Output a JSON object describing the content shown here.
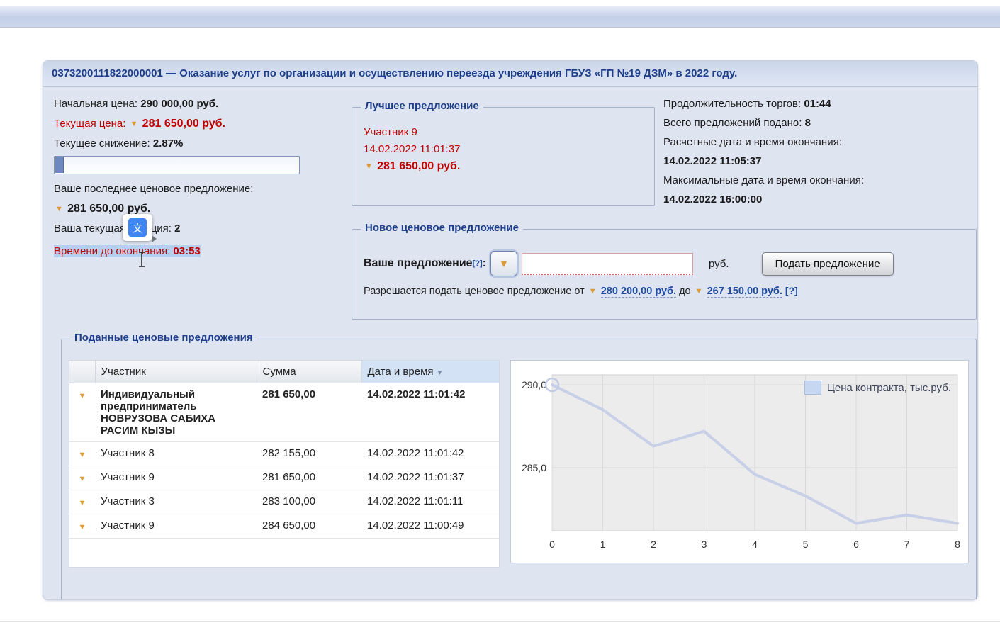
{
  "title": "0373200111822000001 — Оказание услуг по организации и осуществлению переезда учреждения ГБУЗ «ГП №19 ДЗМ» в 2022 году.",
  "left_panel": {
    "initial_price_label": "Начальная цена:",
    "initial_price_value": "290 000,00 руб.",
    "current_price_label": "Текущая цена:",
    "current_price_value": "281 650,00 руб.",
    "current_reduction_label": "Текущее снижение:",
    "current_reduction_value": "2.87%",
    "last_offer_label": "Ваше последнее ценовое предложение:",
    "last_offer_value": "281 650,00 руб.",
    "position_label": "Ваша текущая позиция:",
    "position_value": "2",
    "time_left_label": "Времени до окончания:",
    "time_left_value": "03:53"
  },
  "best_offer": {
    "legend": "Лучшее предложение",
    "participant": "Участник 9",
    "datetime": "14.02.2022 11:01:37",
    "amount": "281 650,00 руб."
  },
  "right_panel": {
    "duration_label": "Продолжительность торгов:",
    "duration_value": "01:44",
    "total_offers_label": "Всего предложений подано:",
    "total_offers_value": "8",
    "calc_end_label": "Расчетные дата и время окончания:",
    "calc_end_value": "14.02.2022 11:05:37",
    "max_end_label": "Максимальные дата и время окончания:",
    "max_end_value": "14.02.2022 16:00:00"
  },
  "new_offer": {
    "legend": "Новое ценовое предложение",
    "your_offer_label": "Ваше предложение",
    "help_mark": "[?]",
    "colon": ":",
    "input_value": "",
    "currency": "руб.",
    "submit_label": "Подать предложение",
    "range_prefix": "Разрешается подать ценовое предложение от",
    "range_from": "280 200,00 руб.",
    "range_to_word": "до",
    "range_to": "267 150,00 руб.",
    "range_help": "[?]"
  },
  "offers_table": {
    "legend": "Поданные ценовые предложения",
    "col_participant": "Участник",
    "col_amount": "Сумма",
    "col_datetime": "Дата и время",
    "rows": [
      {
        "participant": "Индивидуальный предприниматель НОВРУЗОВА САБИХА РАСИМ КЫЗЫ",
        "amount": "281 650,00",
        "datetime": "14.02.2022 11:01:42"
      },
      {
        "participant": "Участник 8",
        "amount": "282 155,00",
        "datetime": "14.02.2022 11:01:42"
      },
      {
        "participant": "Участник 9",
        "amount": "281 650,00",
        "datetime": "14.02.2022 11:01:37"
      },
      {
        "participant": "Участник 3",
        "amount": "283 100,00",
        "datetime": "14.02.2022 11:01:11"
      },
      {
        "participant": "Участник 9",
        "amount": "284 650,00",
        "datetime": "14.02.2022 11:00:49"
      }
    ]
  },
  "chart_data": {
    "type": "line",
    "x": [
      0,
      1,
      2,
      3,
      4,
      5,
      6,
      7,
      8
    ],
    "values": [
      290.0,
      288.5,
      286.3,
      287.2,
      284.6,
      283.3,
      281.65,
      282.15,
      281.65
    ],
    "legend": "Цена контракта, тыс.руб.",
    "xtick_labels": [
      "0",
      "1",
      "2",
      "3",
      "4",
      "5",
      "6",
      "7",
      "8"
    ],
    "yticks": [
      290.0,
      285.0
    ],
    "ytick_labels": [
      "290,0",
      "285,0"
    ],
    "ylim": [
      281.2,
      290.6
    ],
    "grid": true,
    "legend_position": "top-right",
    "line_color": "#c8d0e8",
    "plot_bg": "#ececec",
    "grid_color": "#d9d9d9",
    "first_point_marker": true
  },
  "icons": {
    "down_arrow": "▼",
    "sort_desc": "▼",
    "translate_glyph": "文"
  },
  "colors": {
    "red": "#c00000",
    "navy": "#1d3e8a",
    "link": "#1c4ba0",
    "orange_arrow": "#dd9a33",
    "selection": "#b5cfee",
    "container_bg": "#dfe4f1"
  }
}
